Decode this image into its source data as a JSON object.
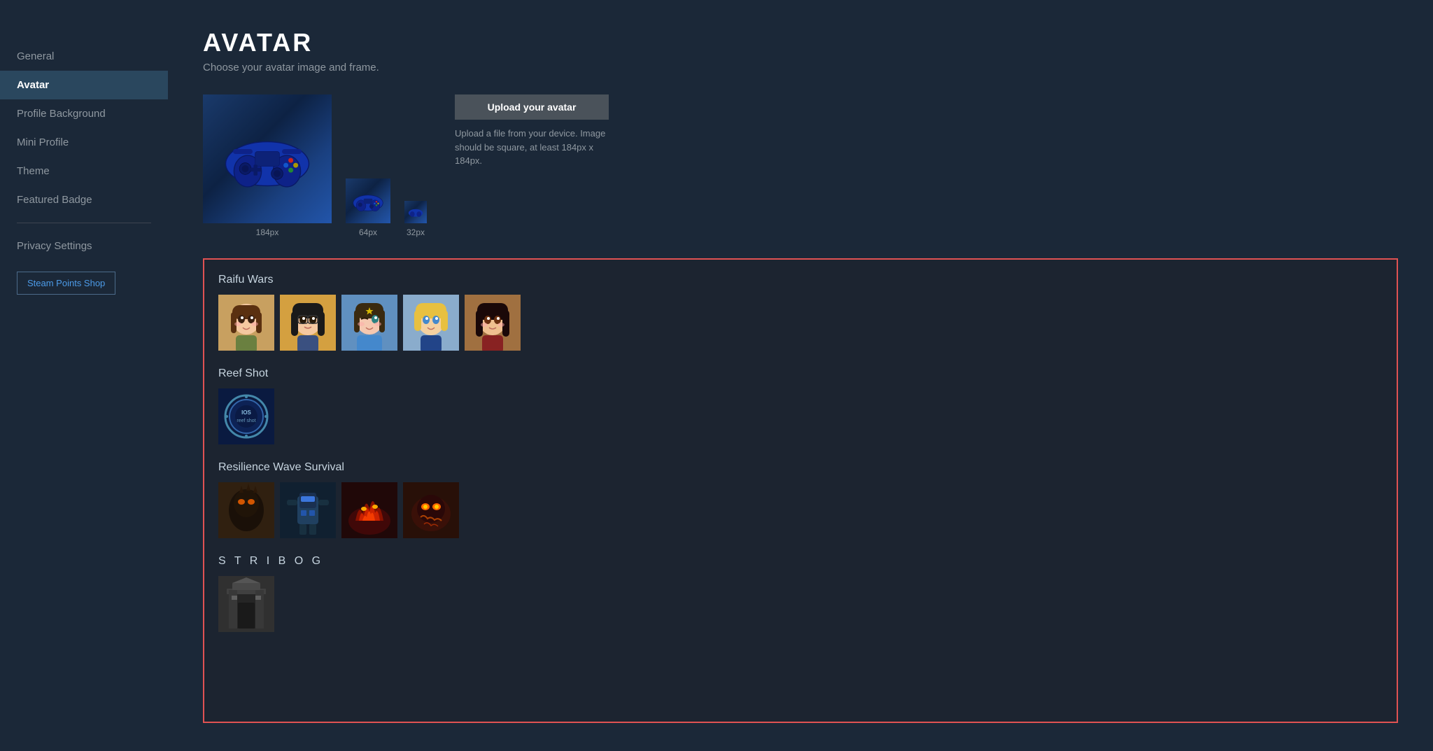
{
  "sidebar": {
    "items": [
      {
        "id": "general",
        "label": "General",
        "active": false
      },
      {
        "id": "avatar",
        "label": "Avatar",
        "active": true
      },
      {
        "id": "profile-background",
        "label": "Profile Background",
        "active": false
      },
      {
        "id": "mini-profile",
        "label": "Mini Profile",
        "active": false
      },
      {
        "id": "theme",
        "label": "Theme",
        "active": false
      },
      {
        "id": "featured-badge",
        "label": "Featured Badge",
        "active": false
      },
      {
        "id": "privacy-settings",
        "label": "Privacy Settings",
        "active": false
      }
    ],
    "steam_points_shop_label": "Steam Points Shop"
  },
  "header": {
    "title": "AVATAR",
    "subtitle": "Choose your avatar image and frame."
  },
  "avatar_previews": [
    {
      "size": "184px",
      "label": "184px"
    },
    {
      "size": "64px",
      "label": "64px"
    },
    {
      "size": "32px",
      "label": "32px"
    }
  ],
  "upload": {
    "button_label": "Upload your avatar",
    "description": "Upload a file from your device. Image should be square, at least 184px x 184px."
  },
  "library": {
    "sections": [
      {
        "id": "raifu-wars",
        "title": "Raifu Wars",
        "avatars": [
          {
            "id": "rw1",
            "css_class": "raifu-1",
            "emoji": "🧑"
          },
          {
            "id": "rw2",
            "css_class": "raifu-2",
            "emoji": "👩"
          },
          {
            "id": "rw3",
            "css_class": "raifu-3",
            "emoji": "👧"
          },
          {
            "id": "rw4",
            "css_class": "raifu-4",
            "emoji": "👦"
          },
          {
            "id": "rw5",
            "css_class": "raifu-5",
            "emoji": "🧒"
          }
        ]
      },
      {
        "id": "reef-shot",
        "title": "Reef Shot",
        "avatars": [
          {
            "id": "rs1",
            "css_class": "reef-1",
            "emoji": "🔵"
          }
        ]
      },
      {
        "id": "resilience-wave-survival",
        "title": "Resilience Wave Survival",
        "avatars": [
          {
            "id": "rws1",
            "css_class": "rws-1",
            "emoji": "👹"
          },
          {
            "id": "rws2",
            "css_class": "rws-2",
            "emoji": "🤖"
          },
          {
            "id": "rws3",
            "css_class": "rws-3",
            "emoji": "🔥"
          },
          {
            "id": "rws4",
            "css_class": "rws-4",
            "emoji": "⚡"
          }
        ]
      },
      {
        "id": "stribog",
        "title": "S T R I B O G",
        "avatars": [
          {
            "id": "stb1",
            "css_class": "stribog-1",
            "emoji": "🏛"
          }
        ]
      }
    ]
  }
}
